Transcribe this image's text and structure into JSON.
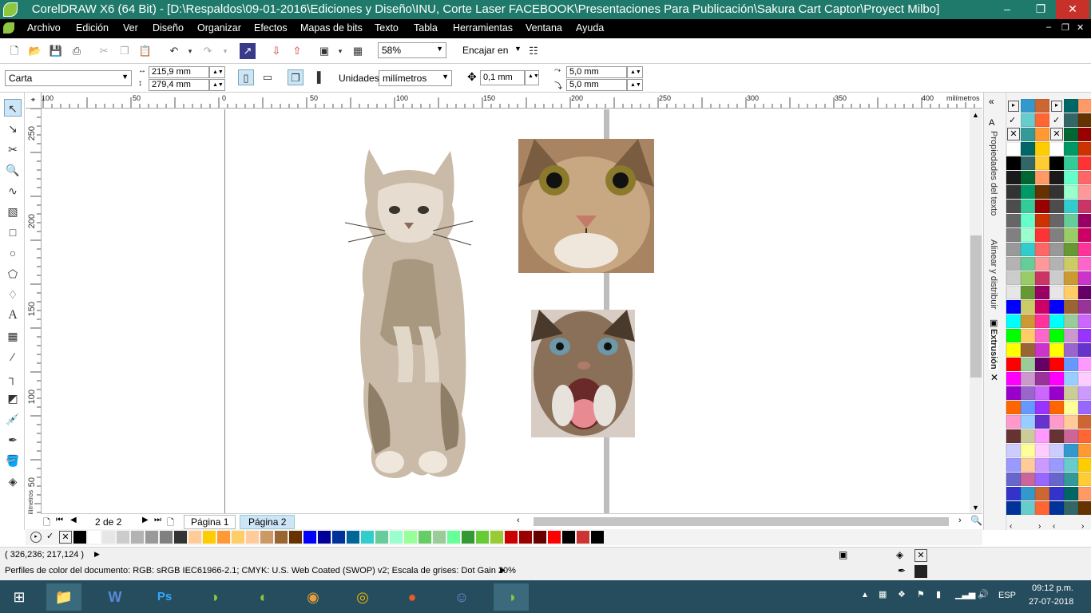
{
  "titlebar": {
    "title": "CorelDRAW X6 (64 Bit) - [D:\\Respaldos\\09-01-2016\\Ediciones y Diseño\\INU, Corte Laser FACEBOOK\\Presentaciones Para Publicación\\Sakura Cart Captor\\Proyect Milbo]",
    "minimize": "–",
    "restore": "❐",
    "close": "✕"
  },
  "menu": {
    "items": [
      "Archivo",
      "Edición",
      "Ver",
      "Diseño",
      "Organizar",
      "Efectos",
      "Mapas de bits",
      "Texto",
      "Tabla",
      "Herramientas",
      "Ventana",
      "Ayuda"
    ],
    "doc_min": "–",
    "doc_restore": "❐",
    "doc_close": "✕"
  },
  "toolbar": {
    "zoom": "58%",
    "snap": "Encajar en"
  },
  "propbar": {
    "page_size": "Carta",
    "width": "215,9 mm",
    "height": "279,4 mm",
    "units_label": "Unidades:",
    "units": "milímetros",
    "nudge": "0,1 mm",
    "dup_x": "5,0 mm",
    "dup_y": "5,0 mm"
  },
  "rulers": {
    "unit": "milímetros",
    "h_ticks": [
      "100",
      "50",
      "0",
      "50",
      "100",
      "150",
      "200",
      "250",
      "300",
      "350",
      "400"
    ],
    "v_ticks": [
      "250",
      "200",
      "150",
      "100",
      "50"
    ],
    "v_unit": "milímetros"
  },
  "pages": {
    "counter": "2 de 2",
    "tabs": [
      "Página 1",
      "Página 2"
    ],
    "active": 1
  },
  "dockers": {
    "tabs": [
      "Propiedades del texto",
      "Alinear y distribuir",
      "Extrusión"
    ]
  },
  "status": {
    "coords": "( 326,236; 217,124 )",
    "color_profiles": "Perfiles de color del documento: RGB: sRGB IEC61966-2.1; CMYK: U.S. Web Coated (SWOP) v2; Escala de grises: Dot Gain 20%"
  },
  "taskbar": {
    "lang": "ESP",
    "time": "09:12 p.m.",
    "date": "27-07-2018"
  },
  "colors": {
    "title": "#1f7a6b",
    "accent": "#cde6f7",
    "taskbar": "#264d5e"
  },
  "palette_right": [
    "#ffffff",
    "#000000",
    "#1a1a1a",
    "#333333",
    "#4d4d4d",
    "#666666",
    "#808080",
    "#999999",
    "#b3b3b3",
    "#cccccc",
    "#e6e6e6",
    "#0000ff",
    "#00ffff",
    "#00ff00",
    "#ffff00",
    "#ff0000",
    "#ff00ff",
    "#9900cc",
    "#ff6600",
    "#ff99cc",
    "#663333",
    "#ccccff",
    "#9999ff",
    "#6666cc",
    "#3333cc",
    "#003399",
    "#000066"
  ],
  "palette_right2": [
    "#3399cc",
    "#66cccc",
    "#339999",
    "#006666",
    "#336666",
    "#006633",
    "#009966",
    "#33cc99",
    "#66ffcc",
    "#99ffcc",
    "#33cccc",
    "#66cc99",
    "#99cc66",
    "#669933",
    "#cccc66",
    "#cc9933",
    "#ffcc66",
    "#996633",
    "#99cc99",
    "#cc99cc",
    "#9966cc",
    "#6699ff",
    "#99ccff",
    "#cccc99",
    "#ffff99",
    "#ffcc99",
    "#cc6699"
  ],
  "palette_right3": [
    "#cc6633",
    "#ff6633",
    "#ff9933",
    "#ffcc00",
    "#ffcc33",
    "#ff9966",
    "#663300",
    "#990000",
    "#cc3300",
    "#ff3333",
    "#ff6666",
    "#ff9999",
    "#cc3366",
    "#990066",
    "#cc0066",
    "#ff3399",
    "#ff66cc",
    "#cc33cc",
    "#660066",
    "#993399",
    "#cc66ff",
    "#9933ff",
    "#6633cc",
    "#ff99ff",
    "#ffccff",
    "#cc99ff",
    "#9966ff"
  ],
  "palette_bottom": [
    "#000000",
    "#ffffff",
    "#e6e6e6",
    "#cccccc",
    "#b3b3b3",
    "#999999",
    "#808080",
    "#333333",
    "#ffcc99",
    "#ffcc00",
    "#ff9933",
    "#ffcc66",
    "#ffcc99",
    "#cc9966",
    "#996633",
    "#663300",
    "#0000ff",
    "#000099",
    "#003399",
    "#006699",
    "#33cccc",
    "#66cc99",
    "#99ffcc",
    "#99ff99",
    "#66cc66",
    "#99cc99",
    "#66ff99",
    "#339933",
    "#66cc33",
    "#99cc33",
    "#cc0000",
    "#990000",
    "#660000",
    "#ff0000",
    "#000000",
    "#cc3333",
    "#000000"
  ]
}
